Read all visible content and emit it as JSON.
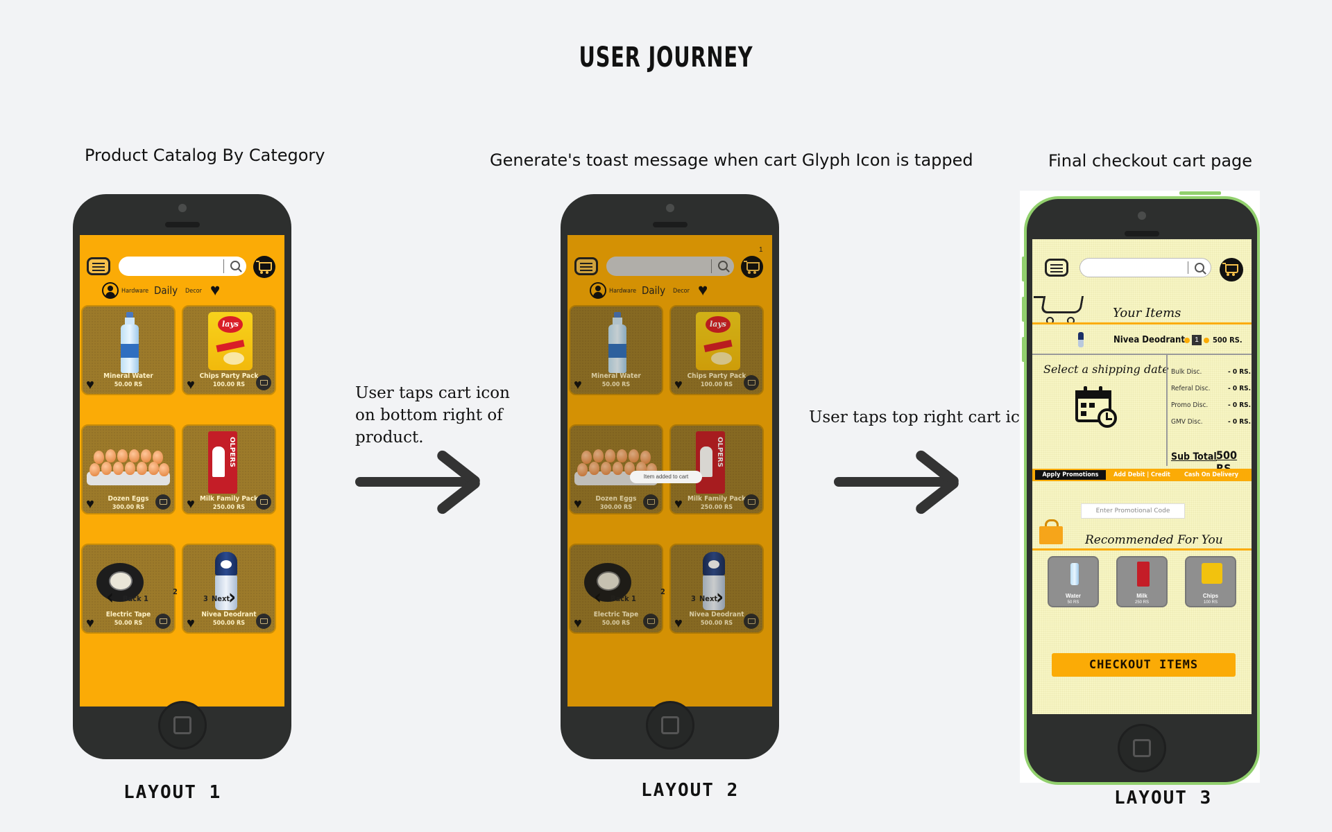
{
  "title": "USER JOURNEY",
  "captions": {
    "layout1": "Product Catalog By Category",
    "layout2": "Generate's toast message when cart Glyph Icon is tapped",
    "layout3": "Final checkout cart page"
  },
  "layout_labels": [
    "LAYOUT 1",
    "LAYOUT 2",
    "LAYOUT 3"
  ],
  "notes": {
    "step1": [
      "User taps cart icon",
      "on bottom right of",
      "product."
    ],
    "step2": "User taps top right cart icon"
  },
  "catalog": {
    "categories": [
      "Hardware",
      "Daily",
      "Decor"
    ],
    "products": [
      {
        "name": "Mineral Water",
        "price": "50.00 RS",
        "icon": "water-bottle"
      },
      {
        "name": "Chips Party Pack",
        "price": "100.00 RS",
        "icon": "chips-bag"
      },
      {
        "name": "Dozen Eggs",
        "price": "300.00 RS",
        "icon": "egg-tray"
      },
      {
        "name": "Milk Family Pack",
        "price": "250.00 RS",
        "icon": "milk-carton"
      },
      {
        "name": "Electric Tape",
        "price": "50.00 RS",
        "icon": "tape-roll"
      },
      {
        "name": "Nivea Deodrant",
        "price": "500.00 RS",
        "icon": "deodorant"
      }
    ],
    "chips_logo": "lays",
    "milk_brand": "OLPERS",
    "pager": {
      "back": "Back",
      "prev": "1",
      "current": "2",
      "next_num": "3",
      "next": "Next"
    }
  },
  "toast": {
    "message": "Item added to cart",
    "cart_count": "1"
  },
  "checkout": {
    "your_items": "Your Items",
    "item": {
      "name": "Nivea Deodrant",
      "qty": "1",
      "price": "500 RS."
    },
    "shipping_label": "Select a shipping date",
    "discounts": [
      {
        "label": "Bulk Disc.",
        "value": "- 0 RS."
      },
      {
        "label": "Referal Disc.",
        "value": "- 0 RS."
      },
      {
        "label": "Promo Disc.",
        "value": "- 0 RS."
      },
      {
        "label": "GMV Disc.",
        "value": "- 0 RS."
      }
    ],
    "subtotal_label": "Sub Total",
    "subtotal_value": "500 RS.",
    "tabs": [
      "Apply Promotions",
      "Add Debit | Credit",
      "Cash On Delivery"
    ],
    "promo_placeholder": "Enter Promotional Code",
    "recommended_label": "Recommended For You",
    "recommended": [
      {
        "name": "Water",
        "price": "50 RS"
      },
      {
        "name": "Milk",
        "price": "250 RS"
      },
      {
        "name": "Chips",
        "price": "100 RS"
      }
    ],
    "checkout_button": "CHECKOUT ITEMS"
  },
  "colors": {
    "accent": "#fbab06",
    "phone_body": "#2d2f2e",
    "checkout_bg": "#f7f5c4",
    "phone3_trim": "#92d06e"
  }
}
